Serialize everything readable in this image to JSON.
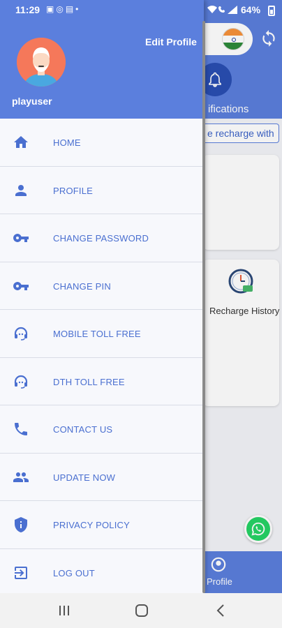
{
  "status_bar": {
    "time": "11:29",
    "left_icons": [
      "gallery-icon",
      "whatsapp-icon",
      "alarm-icon",
      "dot-icon"
    ],
    "right_icons": [
      "wifi-icon",
      "call-icon",
      "signal-icon"
    ],
    "battery": "64%"
  },
  "drawer": {
    "edit_profile_label": "Edit Profile",
    "username": "playuser",
    "items": [
      {
        "label": "HOME",
        "icon": "home-icon"
      },
      {
        "label": "PROFILE",
        "icon": "person-icon"
      },
      {
        "label": "CHANGE PASSWORD",
        "icon": "key-icon"
      },
      {
        "label": "CHANGE PIN",
        "icon": "key-icon"
      },
      {
        "label": "MOBILE TOLL FREE",
        "icon": "support-agent-icon"
      },
      {
        "label": "DTH TOLL FREE",
        "icon": "support-agent-icon"
      },
      {
        "label": "CONTACT US",
        "icon": "phone-icon"
      },
      {
        "label": "UPDATE NOW",
        "icon": "group-icon"
      },
      {
        "label": "PRIVACY POLICY",
        "icon": "shield-icon"
      },
      {
        "label": "LOG OUT",
        "icon": "logout-icon"
      }
    ]
  },
  "background": {
    "notifications_label": "ifications",
    "marquee_text": "e recharge with",
    "recharge_history_label": "Recharge History",
    "bottom_tab_label": "Profile"
  },
  "colors": {
    "primary": "#5b7fdd",
    "menu_text": "#4a6fd0",
    "drawer_bg": "#f7f8fc"
  }
}
